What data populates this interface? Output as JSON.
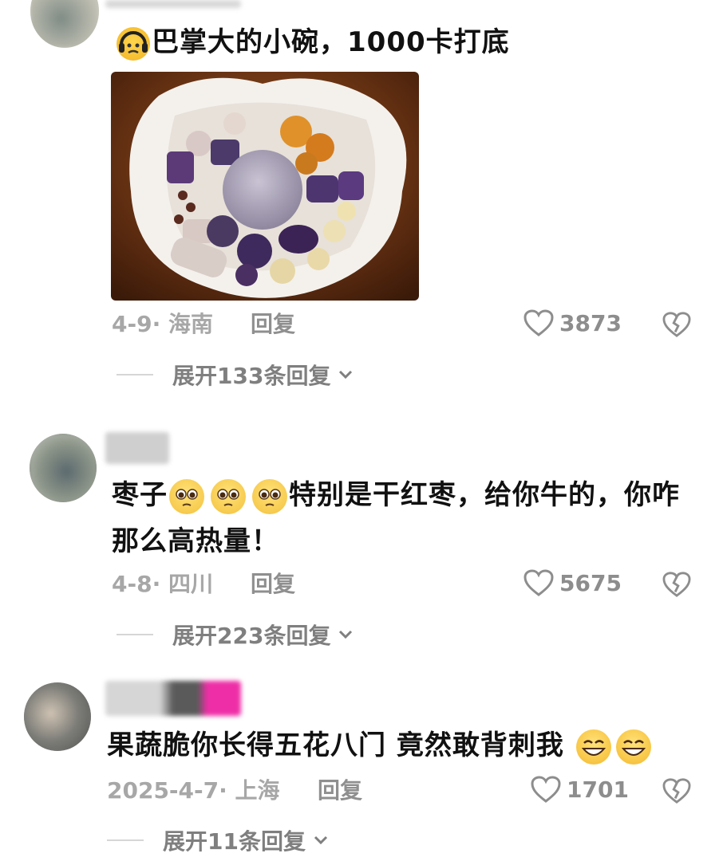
{
  "comments": [
    {
      "text": "巴掌大的小碗，1000卡打底",
      "meta": "4-9· 海南",
      "reply": "回复",
      "likes": "3873",
      "expand": "展开133条回复",
      "emojis": [
        "headphones-face-emoji"
      ],
      "image": "taro-dessert-bowl-photo"
    },
    {
      "text_pre": "枣子",
      "text_post": "特别是干红枣，给你牛的，你咋",
      "text_line2": "那么高热量！",
      "meta": "4-8· 四川",
      "reply": "回复",
      "likes": "5675",
      "expand": "展开223条回复",
      "emojis": [
        "pleading-face-emoji",
        "pleading-face-emoji",
        "pleading-face-emoji"
      ]
    },
    {
      "text": "果蔬脆你长得五花八门 竟然敢背刺我",
      "meta": "2025-4-7· 上海",
      "reply": "回复",
      "likes": "1701",
      "expand": "展开11条回复",
      "emojis": [
        "grinning-face-emoji",
        "grinning-face-emoji"
      ]
    }
  ],
  "colors": {
    "text": "#111111",
    "meta": "#a7a7a7",
    "icon": "#8d8d8d",
    "divider": "#d6d6d6"
  }
}
